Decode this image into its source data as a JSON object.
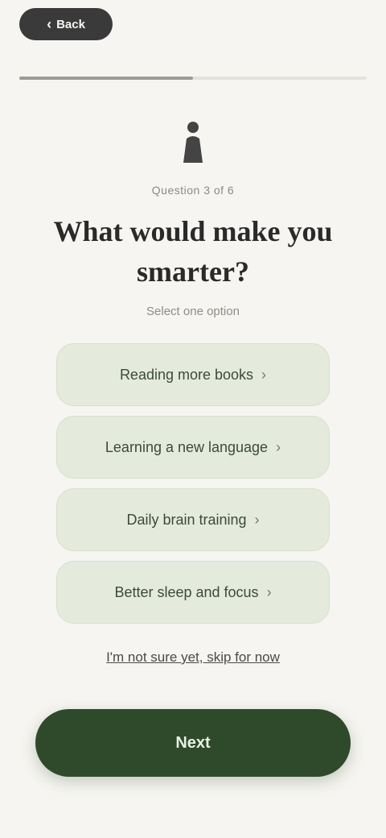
{
  "header": {
    "back_label": "Back",
    "progress_fraction": 0.5
  },
  "hero": {
    "icon": "person-icon"
  },
  "question": {
    "step_label": "Question 3 of 6",
    "title": "What would make you smarter?",
    "hint": "Select one option"
  },
  "options": [
    {
      "label": "Reading more books"
    },
    {
      "label": "Learning a new language"
    },
    {
      "label": "Daily brain training"
    },
    {
      "label": "Better sleep and focus"
    }
  ],
  "skip_label": "I'm not sure yet, skip for now",
  "cta_label": "Next",
  "colors": {
    "background": "#f6f5f1",
    "accent": "#2e4a2a",
    "option_bg": "#e4ebdc"
  }
}
